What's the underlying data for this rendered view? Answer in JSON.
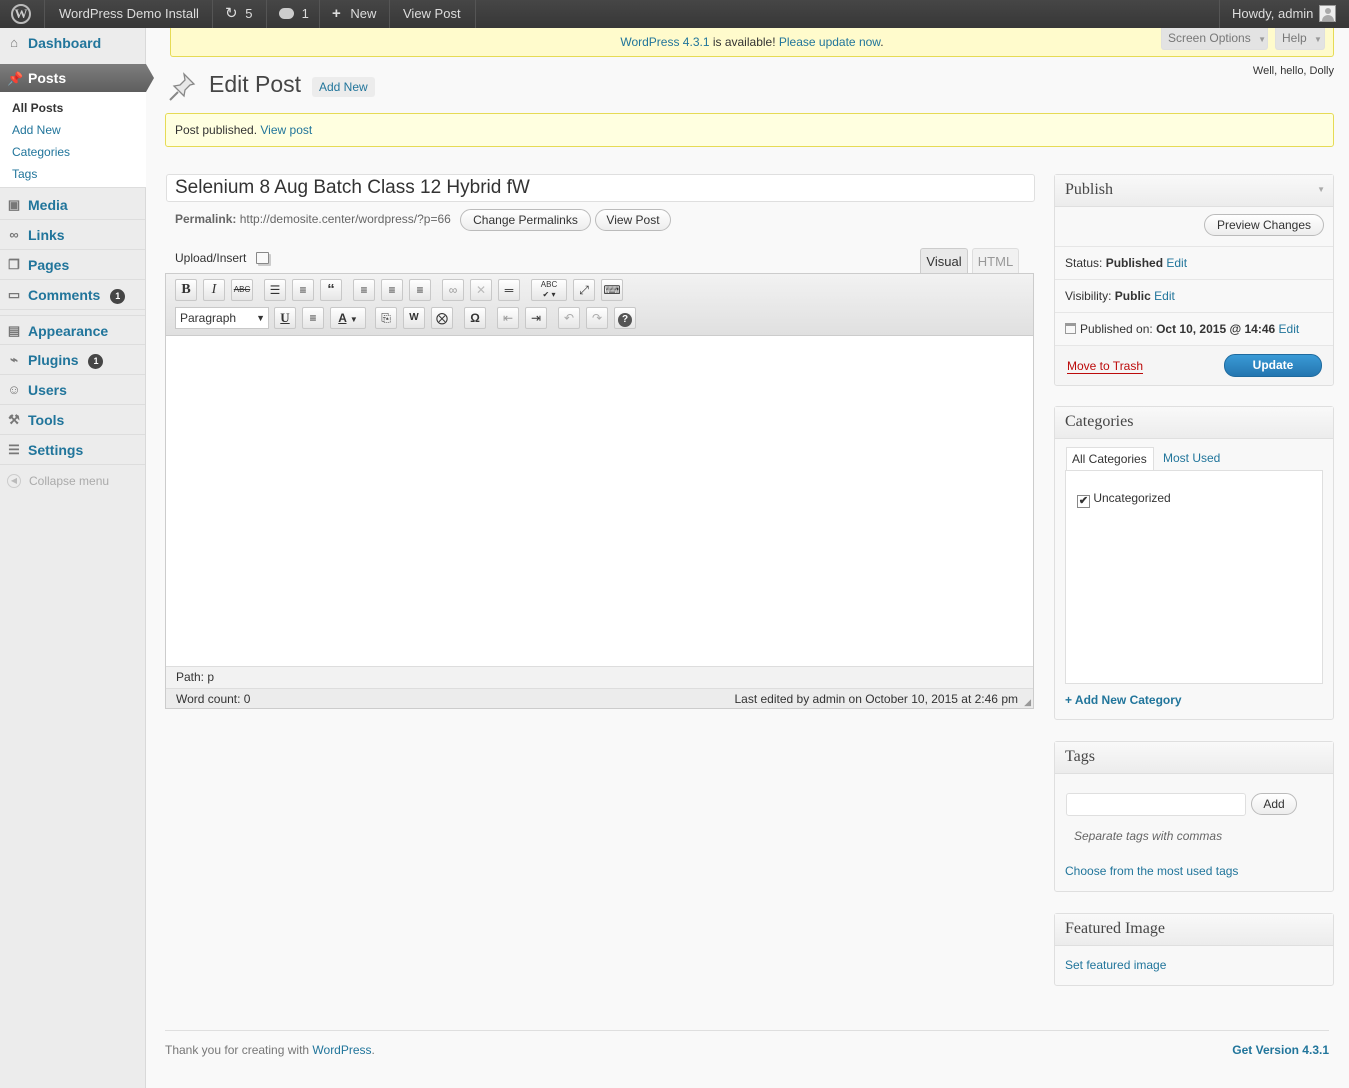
{
  "adminbar": {
    "site_name": "WordPress Demo Install",
    "updates_count": "5",
    "comments_count": "1",
    "new_label": "New",
    "view_post_label": "View Post",
    "howdy": "Howdy, admin"
  },
  "update_nag": {
    "link_version": "WordPress 4.3.1",
    "text": " is available! ",
    "link_update": "Please update now",
    "period": "."
  },
  "screen_options_label": "Screen Options",
  "help_label": "Help",
  "dolly_text": "Well, hello, Dolly",
  "sidebar": {
    "dashboard": "Dashboard",
    "posts": "Posts",
    "submenu": [
      "All Posts",
      "Add New",
      "Categories",
      "Tags"
    ],
    "media": "Media",
    "links": "Links",
    "pages": "Pages",
    "comments": "Comments",
    "comments_badge": "1",
    "appearance": "Appearance",
    "plugins": "Plugins",
    "plugins_badge": "1",
    "users": "Users",
    "tools": "Tools",
    "settings": "Settings",
    "collapse": "Collapse menu"
  },
  "page": {
    "title": "Edit Post",
    "add_new": "Add New"
  },
  "notice": {
    "text": "Post published. ",
    "link": "View post"
  },
  "editor": {
    "post_title": "Selenium 8 Aug Batch Class 12 Hybrid fW",
    "permalink_label": "Permalink:",
    "permalink_url": "http://demosite.center/wordpress/?p=66",
    "change_permalinks": "Change Permalinks",
    "view_post": "View Post",
    "upload_insert": "Upload/Insert",
    "tab_visual": "Visual",
    "tab_html": "HTML",
    "format_select": "Paragraph",
    "path_label": "Path:",
    "path_value": "p",
    "word_count": "Word count: 0",
    "last_edited": "Last edited by admin on October 10, 2015 at 2:46 pm"
  },
  "publish": {
    "title": "Publish",
    "preview": "Preview Changes",
    "status_label": "Status: ",
    "status_value": "Published",
    "visibility_label": "Visibility: ",
    "visibility_value": "Public",
    "published_label": "Published on: ",
    "published_value": "Oct 10, 2015 @ 14:46",
    "edit": "Edit",
    "trash": "Move to Trash",
    "update": "Update"
  },
  "categories": {
    "title": "Categories",
    "tab_all": "All Categories",
    "tab_most": "Most Used",
    "items": [
      {
        "label": "Uncategorized",
        "checked": true
      }
    ],
    "add_new": "+ Add New Category"
  },
  "tags": {
    "title": "Tags",
    "add": "Add",
    "hint": "Separate tags with commas",
    "choose": "Choose from the most used tags"
  },
  "featured": {
    "title": "Featured Image",
    "link": "Set featured image"
  },
  "footer": {
    "thanks": "Thank you for creating with ",
    "wp_link": "WordPress",
    "period": ".",
    "version": "Get Version 4.3.1"
  },
  "colors": {
    "link": "#21759b",
    "adminbar": "#464646",
    "notice_bg": "#ffffe0",
    "update_btn": "#2e8ec6",
    "trash": "#bc0b0b"
  }
}
